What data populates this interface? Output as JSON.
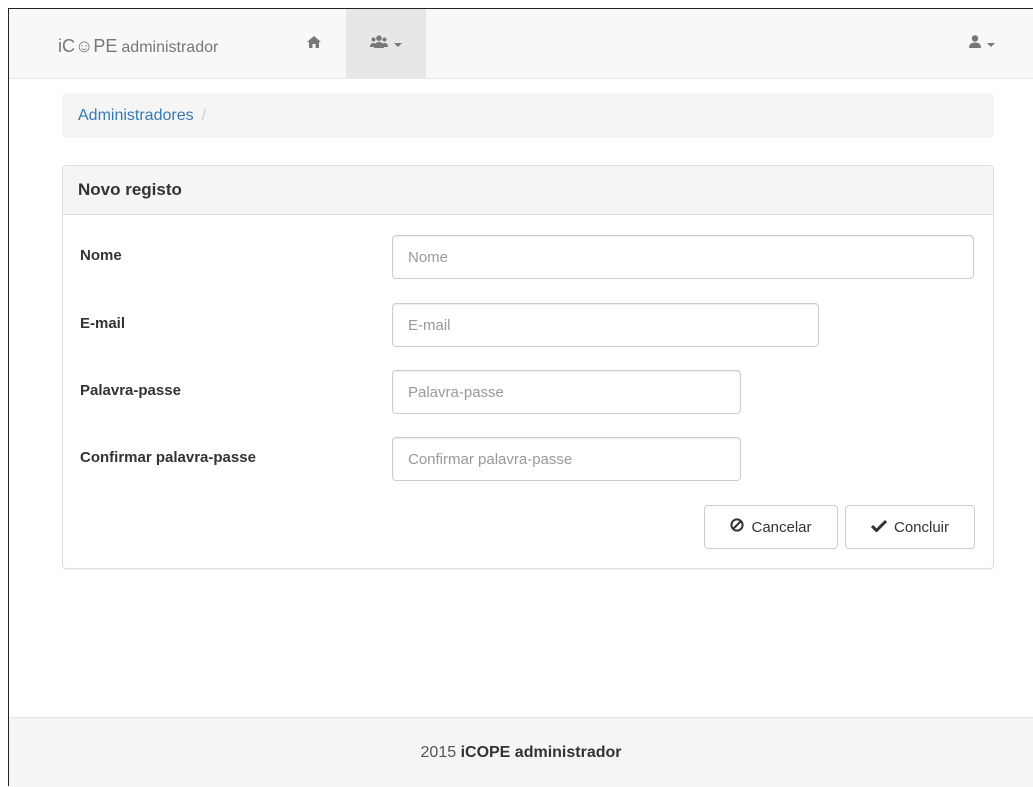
{
  "navbar": {
    "brand_main": "iC☺PE",
    "brand_sub": "administrador",
    "home_icon": "home-icon",
    "users_icon": "users-icon",
    "user_icon": "user-icon"
  },
  "breadcrumb": {
    "items": [
      "Administradores"
    ],
    "separator": "/"
  },
  "panel": {
    "title": "Novo registo",
    "fields": [
      {
        "label": "Nome",
        "placeholder": "Nome",
        "value": ""
      },
      {
        "label": "E-mail",
        "placeholder": "E-mail",
        "value": ""
      },
      {
        "label": "Palavra-passe",
        "placeholder": "Palavra-passe",
        "value": ""
      },
      {
        "label": "Confirmar palavra-passe",
        "placeholder": "Confirmar palavra-passe",
        "value": ""
      }
    ],
    "buttons": {
      "cancel_label": "Cancelar",
      "cancel_icon": "ban-icon",
      "submit_label": "Concluir",
      "submit_icon": "check-icon"
    }
  },
  "footer": {
    "year": "2015",
    "app_name": "iCOPE administrador"
  },
  "colors": {
    "link": "#337ab7",
    "navbar_bg": "#f8f8f8",
    "active_nav_bg": "#e7e7e7",
    "panel_heading_bg": "#f5f5f5"
  }
}
